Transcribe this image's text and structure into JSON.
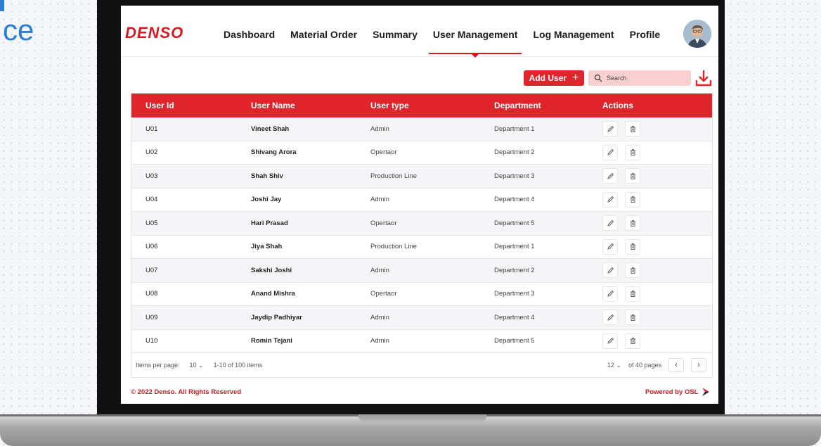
{
  "backdrop": {
    "text_fragment": "ce"
  },
  "brand": {
    "logo": "DENSO",
    "accent": "#e0242c"
  },
  "nav": {
    "items": [
      {
        "label": "Dashboard"
      },
      {
        "label": "Material Order"
      },
      {
        "label": "Summary"
      },
      {
        "label": "User Management"
      },
      {
        "label": "Log Management"
      },
      {
        "label": "Profile"
      }
    ],
    "active": "User Management"
  },
  "toolbar": {
    "add_user_label": "Add User",
    "add_icon": "plus-icon",
    "search_placeholder": "Search",
    "download_icon": "download-icon"
  },
  "table": {
    "columns": [
      "User Id",
      "User Name",
      "User type",
      "Department",
      "Actions"
    ],
    "rows": [
      {
        "id": "U01",
        "name": "Vineet Shah",
        "type": "Admin",
        "department": "Department 1"
      },
      {
        "id": "U02",
        "name": "Shivang Arora",
        "type": "Opertaor",
        "department": "Department 2"
      },
      {
        "id": "U03",
        "name": "Shah Shiv",
        "type": "Production Line",
        "department": "Department 3"
      },
      {
        "id": "U04",
        "name": "Joshi Jay",
        "type": "Admin",
        "department": "Department 4"
      },
      {
        "id": "U05",
        "name": "Hari Prasad",
        "type": "Opertaor",
        "department": "Department 5"
      },
      {
        "id": "U06",
        "name": "Jiya Shah",
        "type": "Production Line",
        "department": "Department 1"
      },
      {
        "id": "U07",
        "name": "Sakshi Joshi",
        "type": "Admin",
        "department": "Department 2"
      },
      {
        "id": "U08",
        "name": "Anand Mishra",
        "type": "Opertaor",
        "department": "Department 3"
      },
      {
        "id": "U09",
        "name": "Jaydip Padhiyar",
        "type": "Admin",
        "department": "Department 4"
      },
      {
        "id": "U10",
        "name": "Romin Tejani",
        "type": "Admin",
        "department": "Department 5"
      }
    ],
    "action_icons": [
      "edit-icon",
      "delete-icon"
    ]
  },
  "pagination": {
    "items_per_page_label": "Items per page:",
    "items_per_page": "10",
    "range_text": "1-10 of 100 items",
    "current_page": "12",
    "pages_text": "of 40 pages",
    "prev": "‹",
    "next": "›"
  },
  "footer": {
    "copyright": "© 2022 Denso. All Rights Reserved",
    "powered": "Powered by OSL"
  }
}
